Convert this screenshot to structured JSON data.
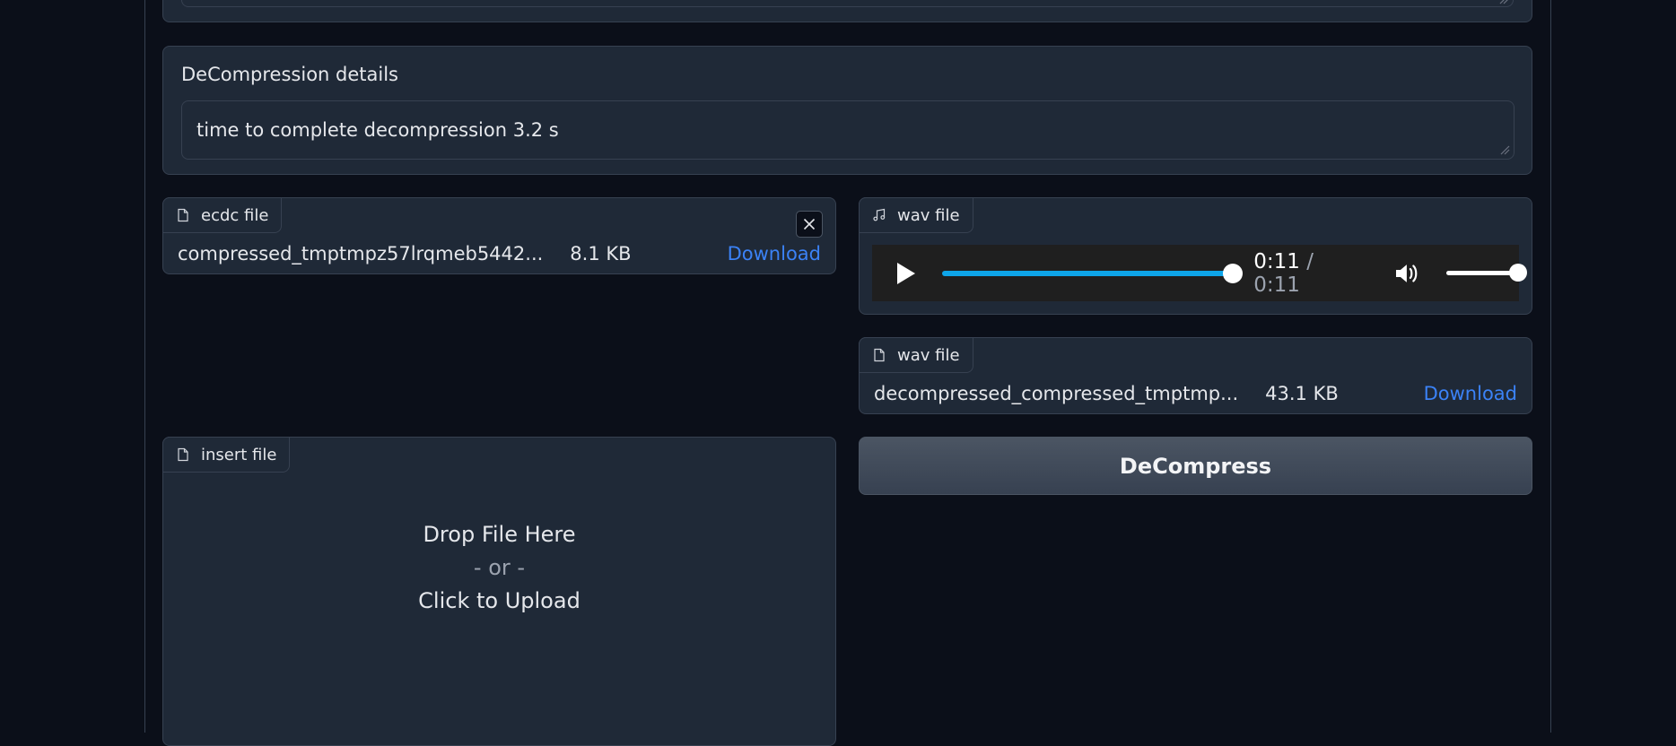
{
  "decompression": {
    "label": "DeCompression details",
    "value": "time to complete decompression 3.2 s"
  },
  "ecdc_file": {
    "tag": "ecdc file",
    "icon": "file-icon",
    "name": "compressed_tmptmpz57lrqmeb5442...",
    "size": "8.1 KB",
    "download": "Download",
    "close_icon": "close-icon"
  },
  "wav_player": {
    "tag": "wav file",
    "icon": "music-icon",
    "current_time": "0:11",
    "separator": "/",
    "duration": "0:11",
    "progress": 1.0,
    "volume": 1.0
  },
  "wav_file": {
    "tag": "wav file",
    "icon": "file-icon",
    "name": "decompressed_compressed_tmptmp...",
    "size": "43.1 KB",
    "download": "Download"
  },
  "insert_file": {
    "tag": "insert file",
    "icon": "file-icon",
    "drop_text": "Drop File Here",
    "or_text": "- or -",
    "click_text": "Click to Upload"
  },
  "decompress_button": "DeCompress",
  "colors": {
    "background": "#0b0f19",
    "panel": "#1f2937",
    "border": "#374151",
    "link": "#3b82f6",
    "progress": "#0ea5e9"
  }
}
